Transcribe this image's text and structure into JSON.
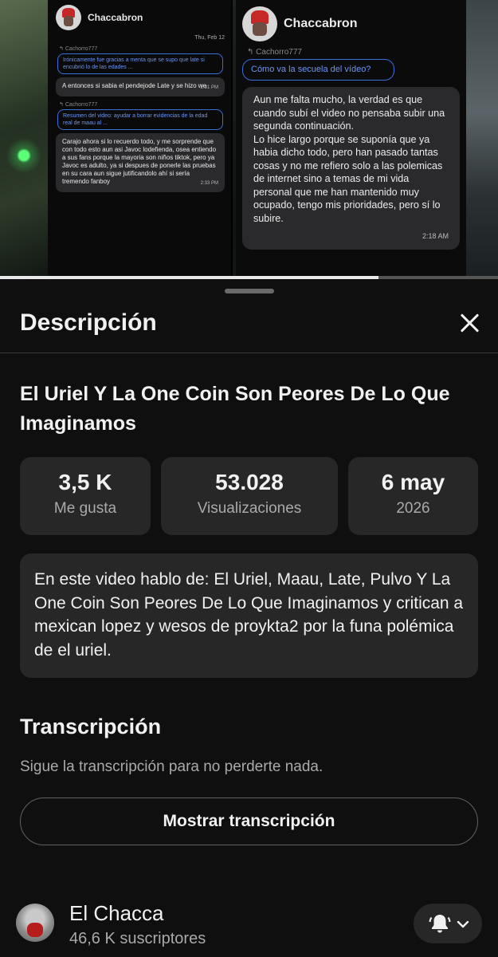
{
  "thumbnail": {
    "chat_left": {
      "contact": "Chaccabron",
      "date": "Thu, Feb 12",
      "messages": [
        {
          "reply_from": "Cachorro777",
          "quote": "Irónicamente fue gracias a menta que se supo que late si encubrió lo de las edades ...",
          "text": "A entonces si sabia el pendejode Late y se hizo we",
          "time": "2:31 PM"
        },
        {
          "reply_from": "Cachorro777",
          "quote": "Resumen del video: ayudar a borrar evidencias de la edad real de maau al ...",
          "text": "Carajo ahora si lo recuerdo todo, y me sorprende que con todo esto aun asi Javoc lodefienda, osea entiendo a sus fans porque la mayoria son niños tiktok, pero ya Javoc es adulto, ya si despues de ponerle las pruebas en su cara aun sigue jutificandolo ahí si sería tremendo fanboy",
          "time": "2:33 PM"
        }
      ]
    },
    "chat_right": {
      "contact": "Chaccabron",
      "reply_from": "Cachorro777",
      "quote": "Cómo va la secuela del vídeo?",
      "message_p1": "Aun me falta mucho, la verdad es que cuando subí el video no pensaba subir una segunda continuación.",
      "message_p2": "Lo hice largo porque se suponía que ya habia dicho todo, pero han pasado tantas cosas y no me refiero solo a las polemicas de internet sino a temas de mi vida personal que me han mantenido muy ocupado, tengo mis prioridades, pero sí lo subire.",
      "time": "2:18 AM"
    },
    "progress_fraction": 0.76
  },
  "sheet": {
    "title": "Descripción",
    "close_icon": "close-icon",
    "video_title": "El Uriel Y La One Coin Son Peores De Lo Que Imaginamos",
    "stats": {
      "likes_value": "3,5 K",
      "likes_label": "Me gusta",
      "views_value": "53.028",
      "views_label": "Visualizaciones",
      "date_value": "6 may",
      "date_label": "2026"
    },
    "description": "En este video hablo de: El Uriel, Maau, Late, Pulvo Y La One Coin Son Peores De Lo Que Imaginamos y critican a mexican lopez y wesos de proykta2 por la funa polémica de el uriel.",
    "transcript": {
      "title": "Transcripción",
      "subtitle": "Sigue la transcripción para no perderte nada.",
      "button": "Mostrar transcripción"
    },
    "channel": {
      "name": "El Chacca",
      "subscribers": "46,6 K suscriptores",
      "bell_icon": "bell-icon",
      "chevron_icon": "chevron-down-icon"
    }
  }
}
